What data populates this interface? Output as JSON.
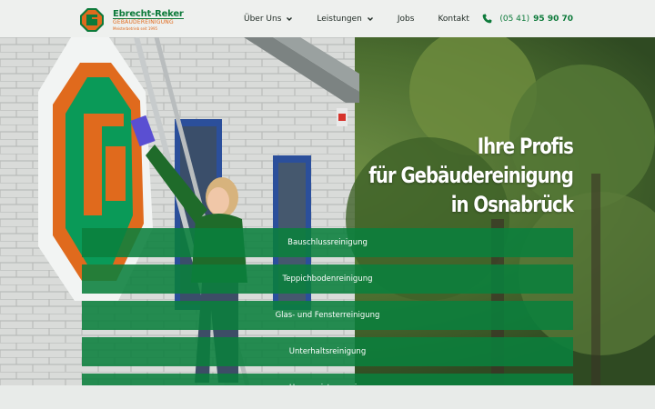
{
  "brand": {
    "name": "Ebrecht-Reker",
    "subtitle": "GEBÄUDEREINIGUNG",
    "tagline": "Meisterbetrieb seit 1995",
    "mark_letters": "ER",
    "colors": {
      "green": "#0d7a3a",
      "orange": "#e06a1d"
    }
  },
  "nav": {
    "items": [
      {
        "label": "Über Uns",
        "has_dropdown": true
      },
      {
        "label": "Leistungen",
        "has_dropdown": true
      },
      {
        "label": "Jobs",
        "has_dropdown": false
      },
      {
        "label": "Kontakt",
        "has_dropdown": false
      }
    ]
  },
  "phone": {
    "prefix": "(05 41)",
    "number": "95 90 70",
    "icon": "phone-icon"
  },
  "hero": {
    "headline": [
      "Ihre Profis",
      "für Gebäudereinigung",
      "in Osnabrück"
    ]
  },
  "services": [
    {
      "label": "Bauschlussreinigung"
    },
    {
      "label": "Teppichbodenreinigung"
    },
    {
      "label": "Glas- und Fensterreinigung"
    },
    {
      "label": "Unterhaltsreinigung"
    },
    {
      "label": "Hausmeisterservice"
    }
  ]
}
